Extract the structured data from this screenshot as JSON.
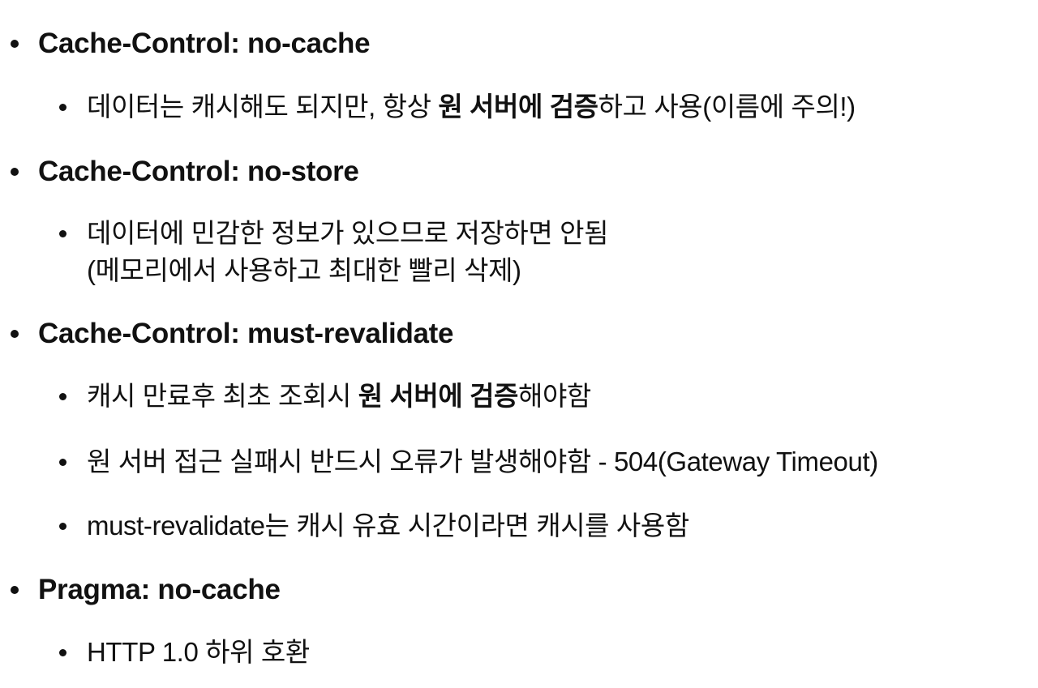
{
  "items": [
    {
      "heading": "Cache-Control: no-cache"
    },
    {
      "pre": "데이터는 캐시해도 되지만, 항상 ",
      "bold": "원 서버에 검증",
      "post": "하고 사용(이름에 주의!)"
    },
    {
      "heading": "Cache-Control: no-store"
    },
    {
      "line1": "데이터에 민감한 정보가 있으므로 저장하면 안됨",
      "line2": "(메모리에서 사용하고 최대한 빨리 삭제)"
    },
    {
      "heading": "Cache-Control: must-revalidate"
    },
    {
      "pre": "캐시 만료후 최초 조회시 ",
      "bold": "원 서버에 검증",
      "post": "해야함"
    },
    {
      "text": "원 서버 접근 실패시 반드시 오류가 발생해야함 - 504(Gateway Timeout)"
    },
    {
      "text": "must-revalidate는 캐시 유효 시간이라면 캐시를 사용함"
    },
    {
      "heading": "Pragma: no-cache"
    },
    {
      "text": "HTTP 1.0 하위 호환"
    }
  ]
}
